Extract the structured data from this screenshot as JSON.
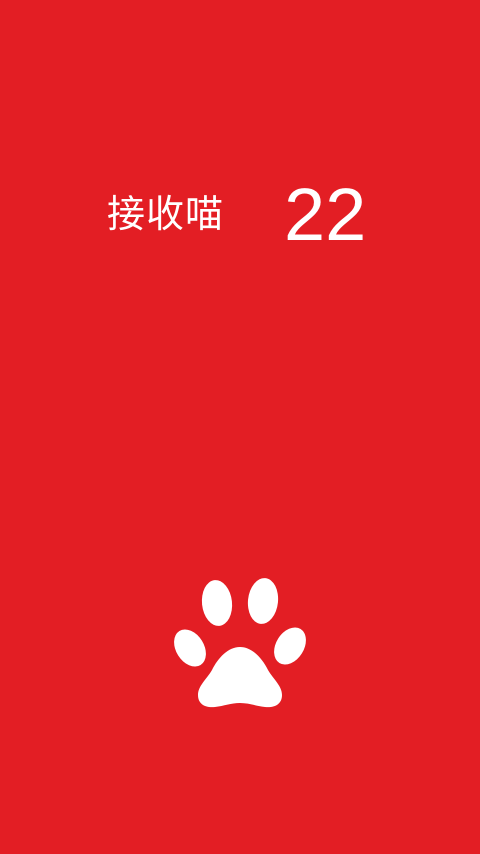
{
  "theme": {
    "background": "#e31e24",
    "foreground": "#ffffff"
  },
  "counter": {
    "label": "接收喵",
    "value": "22"
  },
  "action": {
    "icon": "paw-icon"
  }
}
